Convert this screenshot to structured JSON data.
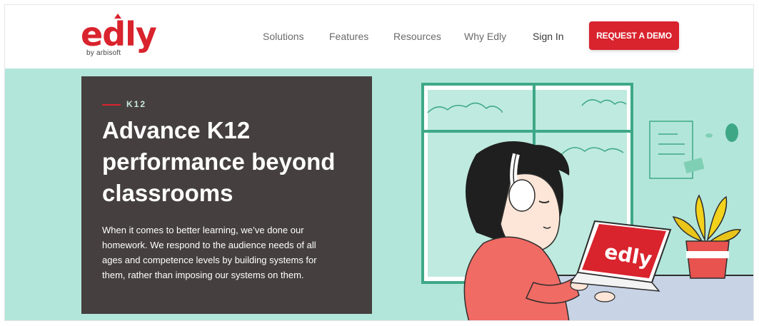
{
  "brand": {
    "logo_text": "edly",
    "logo_sub": "by arbisoft",
    "primary_color": "#d9232d",
    "hero_bg": "#b3e6da",
    "card_bg": "#453f3f"
  },
  "nav": {
    "items": [
      {
        "label": "Solutions"
      },
      {
        "label": "Features"
      },
      {
        "label": "Resources"
      },
      {
        "label": "Why Edly"
      }
    ],
    "signin": "Sign In",
    "cta": "REQUEST A DEMO"
  },
  "hero": {
    "eyebrow": "K12",
    "headline": "Advance K12 performance beyond classrooms",
    "body": "When it comes to better learning, we’ve done our homework. We respond to the audience needs of all ages and competence levels by building systems for them, rather than imposing our systems on them.",
    "illustration": {
      "laptop_logo": "edly"
    }
  }
}
